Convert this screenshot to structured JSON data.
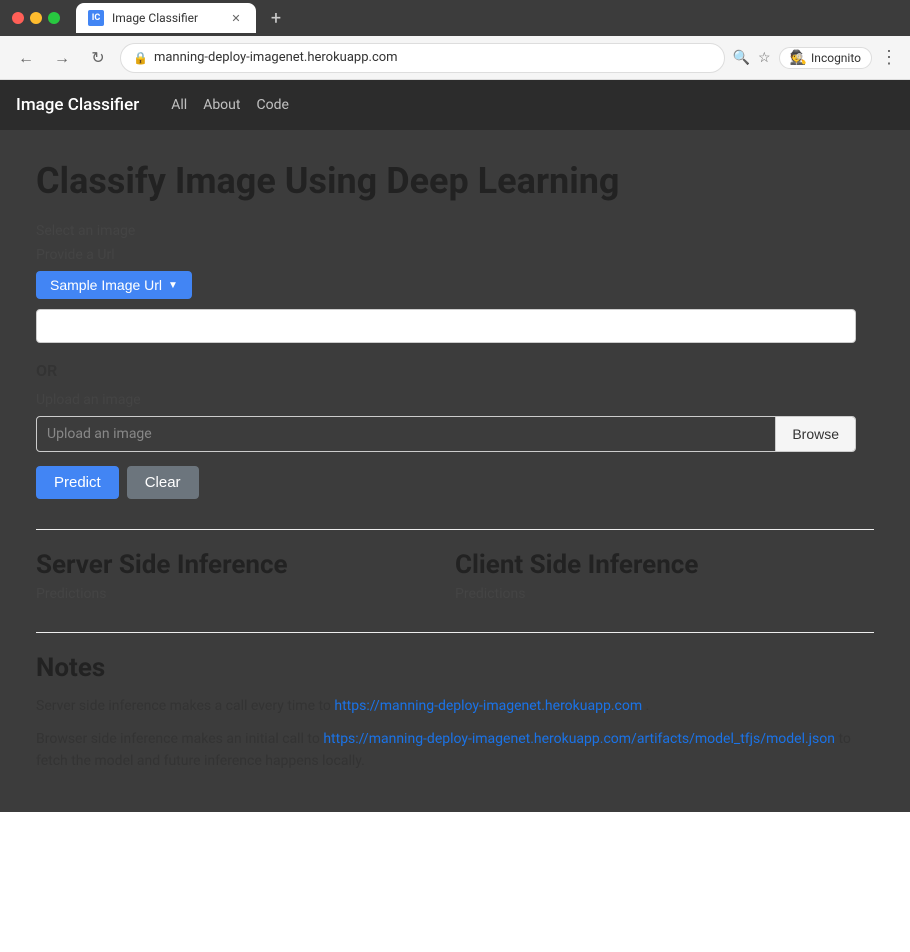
{
  "browser": {
    "tab_title": "Image Classifier",
    "url": "manning-deploy-imagenet.herokuapp.com",
    "incognito_label": "Incognito",
    "new_tab_symbol": "+",
    "back_symbol": "←",
    "forward_symbol": "→",
    "reload_symbol": "↻",
    "search_icon_label": "🔍",
    "star_icon_label": "☆",
    "menu_icon_label": "⋮"
  },
  "navbar": {
    "brand": "Image Classifier",
    "links": [
      {
        "label": "All",
        "id": "all"
      },
      {
        "label": "About",
        "id": "about"
      },
      {
        "label": "Code",
        "id": "code"
      }
    ]
  },
  "main": {
    "page_title": "Classify Image Using Deep Learning",
    "select_label": "Select an image",
    "provide_url_label": "Provide a Url",
    "sample_btn_label": "Sample Image Url",
    "url_placeholder": "",
    "or_divider": "OR",
    "upload_label": "Upload an image",
    "upload_placeholder": "Upload an image",
    "browse_btn": "Browse",
    "predict_btn": "Predict",
    "clear_btn": "Clear",
    "server_inference_title": "Server Side Inference",
    "server_predictions_label": "Predictions",
    "client_inference_title": "Client Side Inference",
    "client_predictions_label": "Predictions",
    "notes_title": "Notes",
    "notes_line1_before": "Server side inference makes a call every time to ",
    "notes_link1": "https://manning-deploy-imagenet.herokuapp.com",
    "notes_line1_after": " .",
    "notes_line2_before": "Browser side inference makes an initial call to ",
    "notes_link2": "https://manning-deploy-imagenet.herokuapp.com/artifacts/model_tfjs/model.json",
    "notes_line2_after": " to fetch the model and future inference happens locally."
  }
}
